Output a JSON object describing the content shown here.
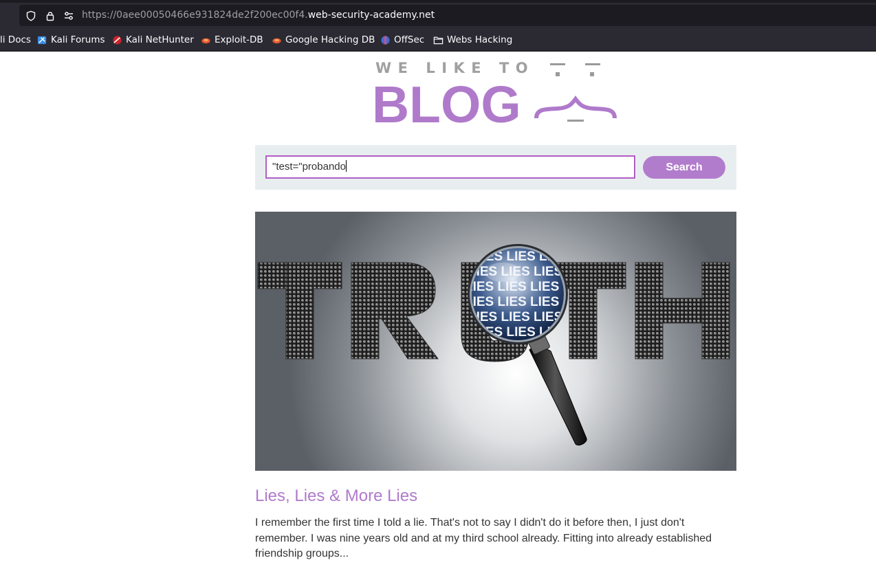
{
  "browser": {
    "url_prefix": "https://0aee00050466e931824de2f200ec00f4.",
    "url_domain": "web-security-academy.net",
    "icons": [
      "shield-icon",
      "lock-icon",
      "permissions-icon"
    ]
  },
  "bookmarks": [
    {
      "label": "li Docs",
      "icon": ""
    },
    {
      "label": "Kali Forums",
      "icon": "kali-forums-icon"
    },
    {
      "label": "Kali NetHunter",
      "icon": "kali-nethunter-icon"
    },
    {
      "label": "Exploit-DB",
      "icon": "exploit-db-icon"
    },
    {
      "label": "Google Hacking DB",
      "icon": "ghdb-icon"
    },
    {
      "label": "OffSec",
      "icon": "offsec-icon"
    },
    {
      "label": "Webs Hacking",
      "icon": "folder-icon"
    }
  ],
  "logo": {
    "line1": "WE LIKE TO",
    "line2": "BLOG",
    "color": "#b07acb"
  },
  "search": {
    "value": "\"test=\"probando",
    "button_label": "Search",
    "accent": "#b27ccd"
  },
  "hero": {
    "word": "TRUTH",
    "lens_text": "LIES LIES LIES LIES LIES"
  },
  "post": {
    "title": "Lies, Lies & More Lies",
    "excerpt": "I remember the first time I told a lie. That's not to say I didn't do it before then, I just don't remember. I was nine years old and at my third school already. Fitting into already established friendship groups..."
  }
}
